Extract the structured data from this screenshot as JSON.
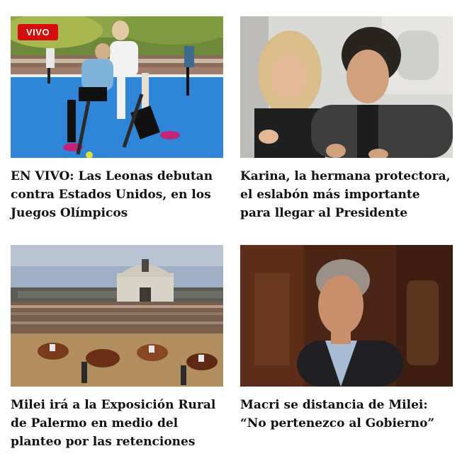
{
  "articles": [
    {
      "badge": "VIVO",
      "headline": "EN VIVO: Las Leonas debutan contra Estados Unidos, en los Juegos Olímpicos",
      "image": "field-hockey-match-photo"
    },
    {
      "badge": "",
      "headline": "Karina, la hermana protectora, el eslabón más importante para llegar al Presidente",
      "image": "karina-and-milei-selfie-photo"
    },
    {
      "badge": "",
      "headline": "Milei irá a la Exposición Rural de Palermo en medio del planteo por las retenciones",
      "image": "rural-exhibition-cattle-photo"
    },
    {
      "badge": "",
      "headline": "Macri se distancia de Milei: “No pertenezco al Gobierno”",
      "image": "macri-portrait-photo"
    }
  ],
  "colors": {
    "badge_bg": "#d50d0d",
    "headline_text": "#111111"
  }
}
